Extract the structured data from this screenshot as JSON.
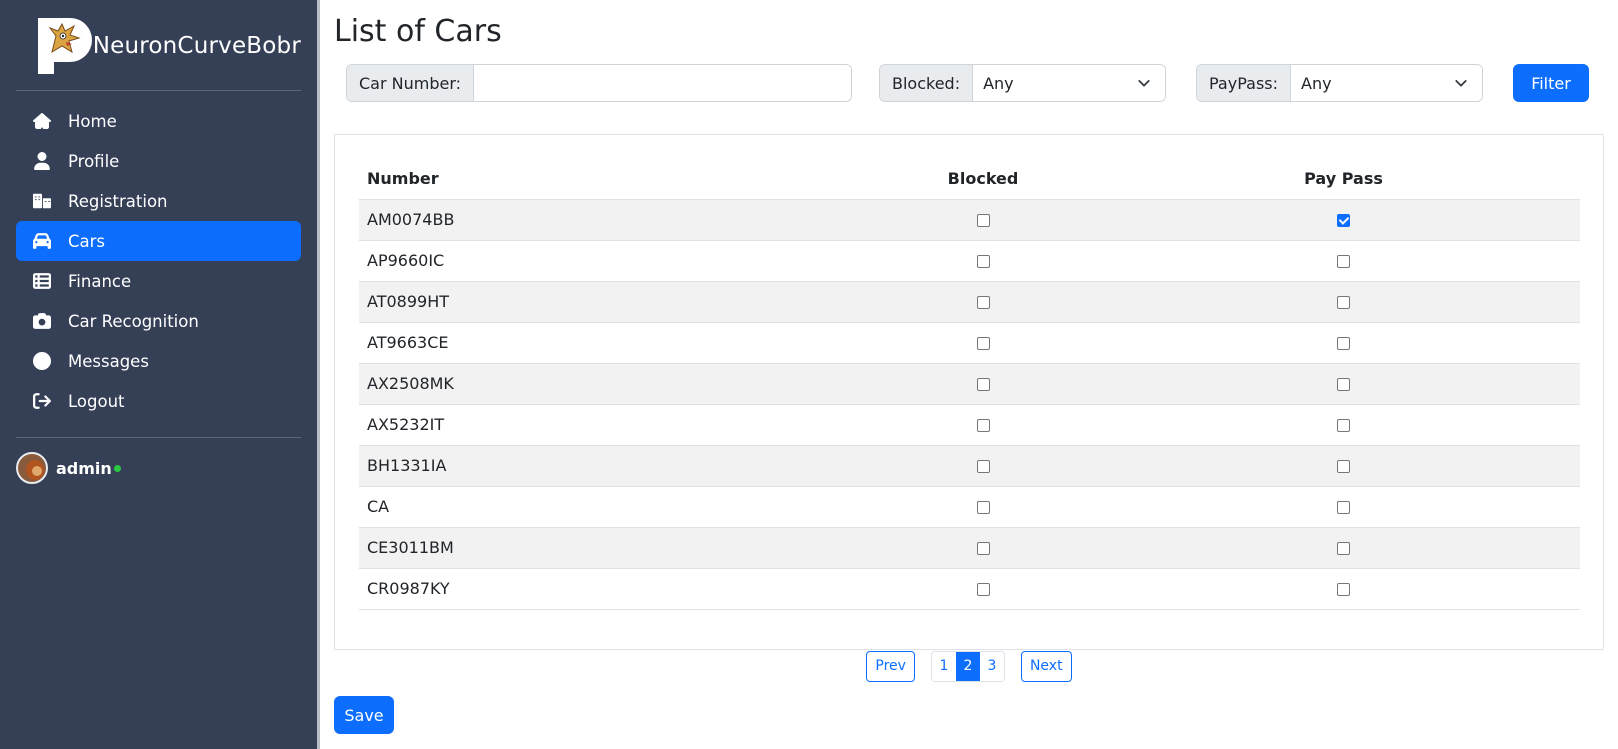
{
  "brand": {
    "name": "NeuronCurveBobr"
  },
  "sidebar": {
    "items": [
      {
        "label": "Home",
        "icon": "home-icon",
        "active": false
      },
      {
        "label": "Profile",
        "icon": "user-icon",
        "active": false
      },
      {
        "label": "Registration",
        "icon": "hotel-icon",
        "active": false
      },
      {
        "label": "Cars",
        "icon": "car-icon",
        "active": true
      },
      {
        "label": "Finance",
        "icon": "table-list-icon",
        "active": false
      },
      {
        "label": "Car Recognition",
        "icon": "camera-icon",
        "active": false
      },
      {
        "label": "Messages",
        "icon": "globe-icon",
        "active": false
      },
      {
        "label": "Logout",
        "icon": "logout-icon",
        "active": false
      }
    ]
  },
  "user": {
    "name": "admin",
    "status_color": "#28c840"
  },
  "page": {
    "title": "List of Cars"
  },
  "filters": {
    "car_number_label": "Car Number:",
    "car_number_value": "",
    "blocked_label": "Blocked:",
    "blocked_value": "Any",
    "paypass_label": "PayPass:",
    "paypass_value": "Any",
    "filter_button": "Filter"
  },
  "table": {
    "headers": {
      "number": "Number",
      "blocked": "Blocked",
      "paypass": "Pay Pass"
    },
    "rows": [
      {
        "number": "AM0074BB",
        "blocked": false,
        "paypass": true
      },
      {
        "number": "AP9660IC",
        "blocked": false,
        "paypass": false
      },
      {
        "number": "AT0899HT",
        "blocked": false,
        "paypass": false
      },
      {
        "number": "AT9663CE",
        "blocked": false,
        "paypass": false
      },
      {
        "number": "AX2508MK",
        "blocked": false,
        "paypass": false
      },
      {
        "number": "AX5232IT",
        "blocked": false,
        "paypass": false
      },
      {
        "number": "BH1331IA",
        "blocked": false,
        "paypass": false
      },
      {
        "number": "CA",
        "blocked": false,
        "paypass": false
      },
      {
        "number": "CE3011BM",
        "blocked": false,
        "paypass": false
      },
      {
        "number": "CR0987KY",
        "blocked": false,
        "paypass": false
      }
    ]
  },
  "pagination": {
    "prev": "Prev",
    "next": "Next",
    "pages": [
      "1",
      "2",
      "3"
    ],
    "current": "2"
  },
  "actions": {
    "save": "Save"
  },
  "colors": {
    "accent": "#0d6efd",
    "sidebar_bg": "#354057"
  }
}
